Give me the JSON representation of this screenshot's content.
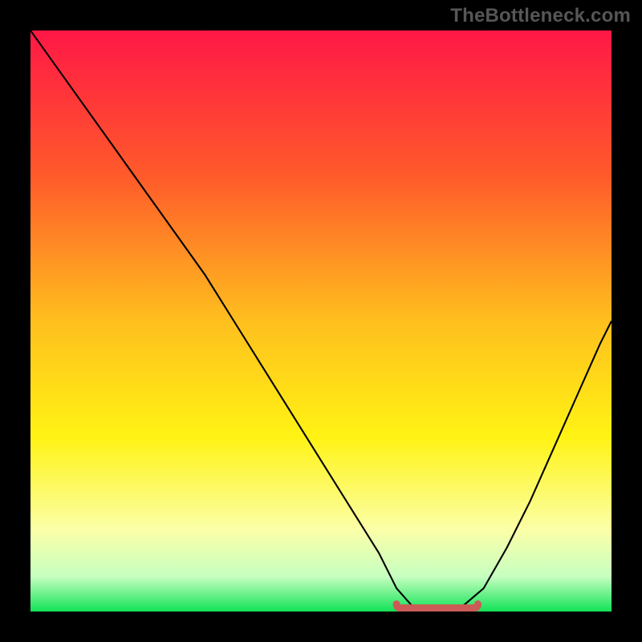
{
  "watermark": "TheBottleneck.com",
  "chart_data": {
    "type": "line",
    "title": "",
    "xlabel": "",
    "ylabel": "",
    "xlim": [
      0,
      100
    ],
    "ylim": [
      0,
      100
    ],
    "background_gradient": {
      "stops": [
        {
          "offset": 0,
          "color": "#ff1846"
        },
        {
          "offset": 25,
          "color": "#ff5a2a"
        },
        {
          "offset": 50,
          "color": "#ffbf1e"
        },
        {
          "offset": 70,
          "color": "#fff314"
        },
        {
          "offset": 86,
          "color": "#fbffa8"
        },
        {
          "offset": 94,
          "color": "#c6ffc0"
        },
        {
          "offset": 100,
          "color": "#12e257"
        }
      ]
    },
    "series": [
      {
        "name": "bottleneck-curve",
        "color": "#000000",
        "x": [
          0,
          5,
          10,
          15,
          20,
          25,
          30,
          35,
          40,
          45,
          50,
          55,
          60,
          63,
          66,
          70,
          74,
          78,
          82,
          86,
          90,
          94,
          98,
          100
        ],
        "y": [
          100,
          93,
          86,
          79,
          72,
          65,
          58,
          50,
          42,
          34,
          26,
          18,
          10,
          4,
          0.6,
          0.6,
          0.6,
          4,
          11,
          19,
          28,
          37,
          46,
          50
        ]
      }
    ],
    "minimum_marker": {
      "color": "#cc5b57",
      "x_start": 63,
      "x_end": 77,
      "y": 0.6
    }
  }
}
